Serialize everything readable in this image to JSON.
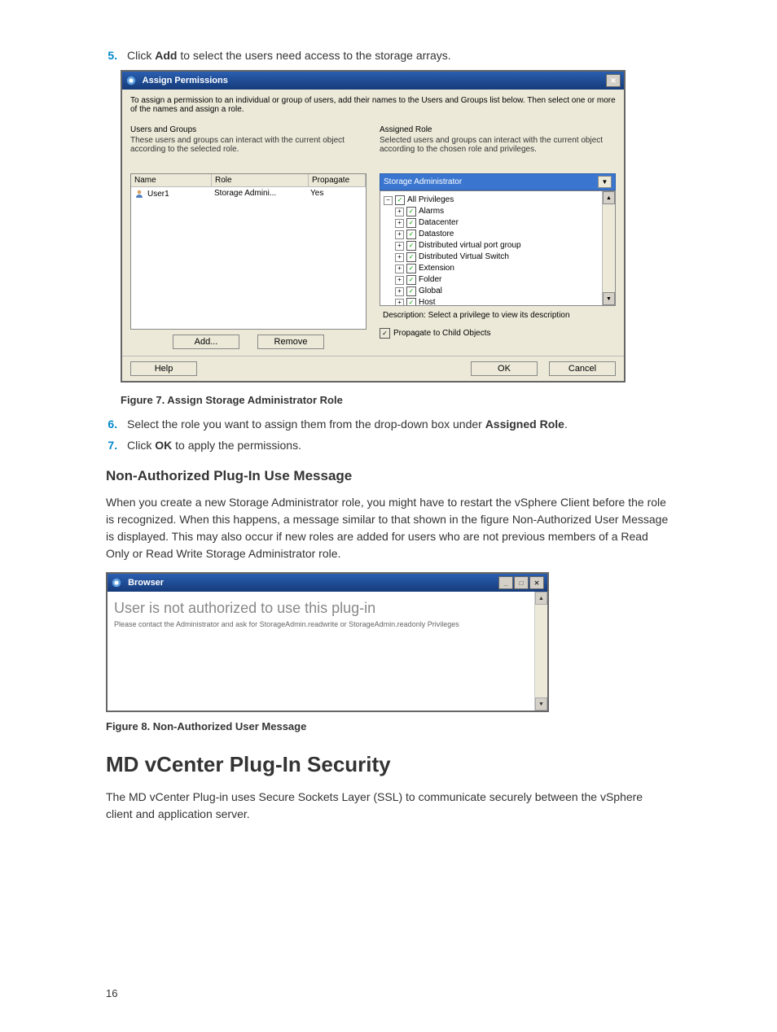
{
  "steps": {
    "s5_pre": "Click ",
    "s5_b": "Add",
    "s5_post": " to select the users need access to the storage arrays.",
    "s6_pre": "Select the role you want to assign them from the drop-down box under ",
    "s6_b": "Assigned Role",
    "s6_post": ".",
    "s7_pre": "Click ",
    "s7_b": "OK",
    "s7_post": " to apply the permissions."
  },
  "dlg": {
    "title": "Assign Permissions",
    "intro": "To assign a permission to an individual or group of users, add their names to the Users and Groups list below. Then select one or more of the names and assign a role.",
    "users_groups_title": "Users and Groups",
    "users_groups_desc": "These users and groups can interact with the current object according to the selected role.",
    "assigned_title": "Assigned Role",
    "assigned_desc": "Selected users and groups can interact with the current object according to the chosen role and privileges.",
    "headers": {
      "name": "Name",
      "role": "Role",
      "prop": "Propagate"
    },
    "row": {
      "name": "User1",
      "role": "Storage Admini...",
      "prop": "Yes"
    },
    "add": "Add...",
    "remove": "Remove",
    "role_selected": "Storage Administrator",
    "tree": [
      "All Privileges",
      "Alarms",
      "Datacenter",
      "Datastore",
      "Distributed virtual port group",
      "Distributed Virtual Switch",
      "Extension",
      "Folder",
      "Global",
      "Host"
    ],
    "tree_desc": "Description:  Select a privilege to view its description",
    "propagate": "Propagate to Child Objects",
    "help": "Help",
    "ok": "OK",
    "cancel": "Cancel"
  },
  "fig7": "Figure 7. Assign Storage Administrator Role",
  "sec_title": "Non-Authorized Plug-In Use Message",
  "sec_body": "When you create a new Storage Administrator role, you might have to restart the vSphere Client before the role is recognized. When this happens, a message similar to that shown in the figure Non-Authorized User Message is displayed. This may also occur if new roles are added for users who are not previous members of a Read Only or Read Write Storage Administrator role.",
  "dlg2": {
    "title": "Browser",
    "heading": "User is not authorized to use this plug-in",
    "sub": "Please contact the Administrator and ask for StorageAdmin.readwrite or StorageAdmin.readonly Privileges"
  },
  "fig8": "Figure 8. Non-Authorized User Message",
  "chap": "MD vCenter Plug-In Security",
  "chap_body": "The MD vCenter Plug-in uses Secure Sockets Layer (SSL) to communicate securely between the vSphere client and application server.",
  "pagenum": "16"
}
